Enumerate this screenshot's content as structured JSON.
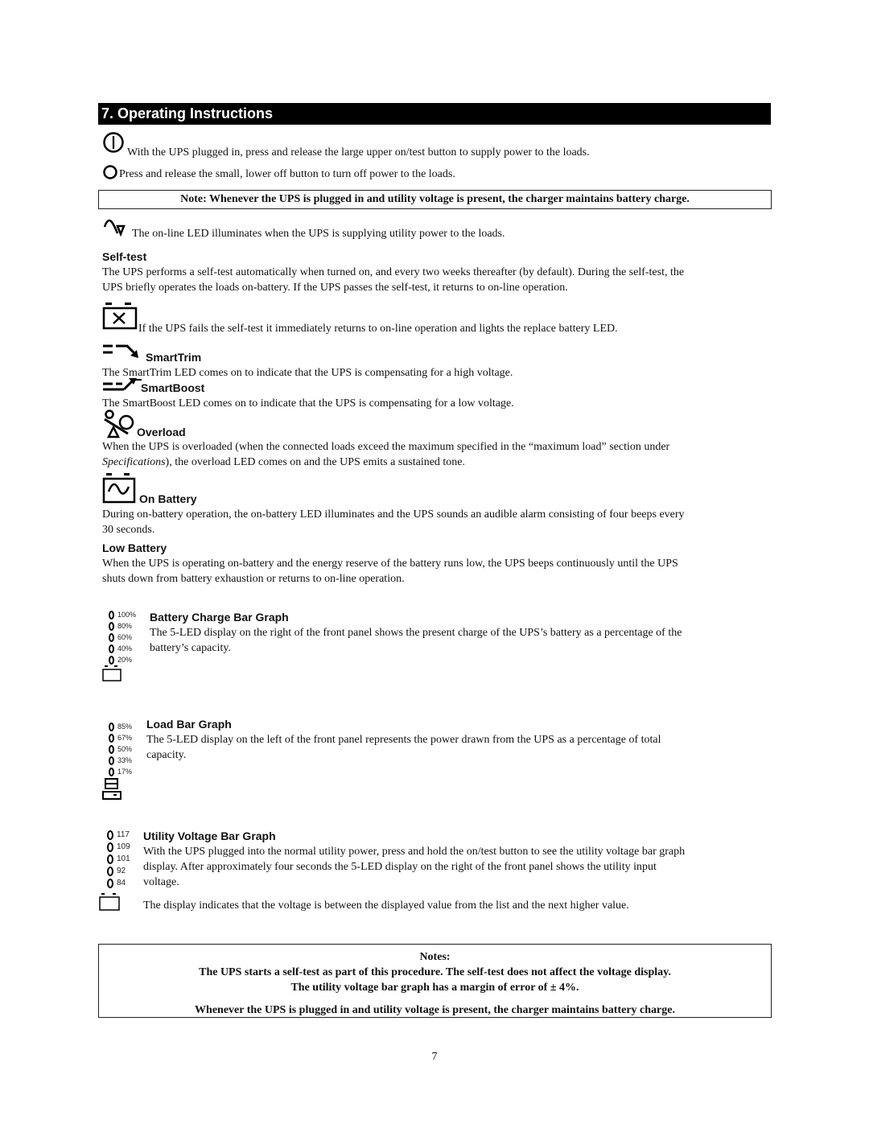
{
  "page": {
    "section_title": "7. Operating Instructions",
    "page_number": "7"
  },
  "intro": {
    "on_test_text": "With the UPS plugged in, press and release the large upper on/test button to supply power to the loads.",
    "off_text": "Press and release the small, lower off button to turn off power to the loads.",
    "note": "Note: Whenever the UPS is plugged in and utility voltage is present, the charger  maintains battery charge.",
    "online_text": "The on-line LED illuminates when the UPS is supplying utility power to the loads."
  },
  "sections": {
    "self_test": {
      "heading": "Self-test",
      "body_line1": "The UPS performs a self-test automatically when turned on, and every two weeks thereafter (by default). During the self-test, the",
      "body_line2": "UPS briefly operates the loads on-battery. If the UPS passes the self-test, it returns to on-line operation.",
      "replace_battery_text": "If the UPS fails the self-test it immediately returns to on-line operation and lights the replace battery LED."
    },
    "smarttrim": {
      "heading": "SmartTrim",
      "body": "The SmartTrim LED comes on to indicate that the UPS is compensating for a high voltage."
    },
    "smartboost": {
      "heading": "SmartBoost",
      "body": "The SmartBoost LED comes on to indicate that the UPS is compensating for a low voltage."
    },
    "overload": {
      "heading": "Overload",
      "body_line1": "When the UPS is overloaded (when the connected loads exceed the maximum specified in the “maximum load” section under",
      "body_line2_italic": "Specifications",
      "body_line2_rest": "), the overload LED comes on and the UPS emits a sustained tone."
    },
    "on_battery": {
      "heading": "On Battery",
      "body_line1": "During on-battery operation, the on-battery LED illuminates and the UPS sounds an audible alarm consisting of four beeps every",
      "body_line2": "30 seconds."
    },
    "low_battery": {
      "heading": "Low Battery",
      "body_line1": "When the UPS is operating on-battery and the energy reserve of the battery runs low, the UPS beeps continuously until the UPS",
      "body_line2": "shuts down from battery exhaustion or returns to on-line operation."
    },
    "battery_charge": {
      "heading": "Battery Charge Bar Graph",
      "body_line1": "The 5-LED display on the right of the front panel shows the present charge of the UPS’s battery as a percentage of the",
      "body_line2": "battery’s capacity.",
      "leds": [
        "100%",
        "80%",
        "60%",
        "40%",
        "20%"
      ]
    },
    "load": {
      "heading": "Load Bar Graph",
      "body_line1": "The 5-LED display on the left of the front panel represents the power drawn from the UPS as a percentage of total",
      "body_line2": "capacity.",
      "leds": [
        "85%",
        "67%",
        "50%",
        "33%",
        "17%"
      ]
    },
    "utility_voltage": {
      "heading": "Utility Voltage Bar Graph",
      "body_line1": "With the UPS plugged into the normal utility power, press and hold the on/test button to see the utility voltage bar graph",
      "body_line2": "display. After approximately four seconds the 5-LED display on the right of the front panel shows the utility input",
      "body_line3": "voltage.",
      "body_para2": "The display indicates that the voltage is between the displayed value from the list and the next higher value.",
      "leds": [
        "117",
        "109",
        "101",
        "92",
        "84"
      ]
    }
  },
  "notes_box": {
    "title": "Notes:",
    "line1": "The UPS starts a self-test as part of this procedure. The self-test does not affect the voltage display.",
    "line2": "The utility voltage bar graph has a margin of error of ± 4%.",
    "line3": "Whenever the UPS is plugged in and utility voltage is present, the charger maintains battery charge."
  }
}
